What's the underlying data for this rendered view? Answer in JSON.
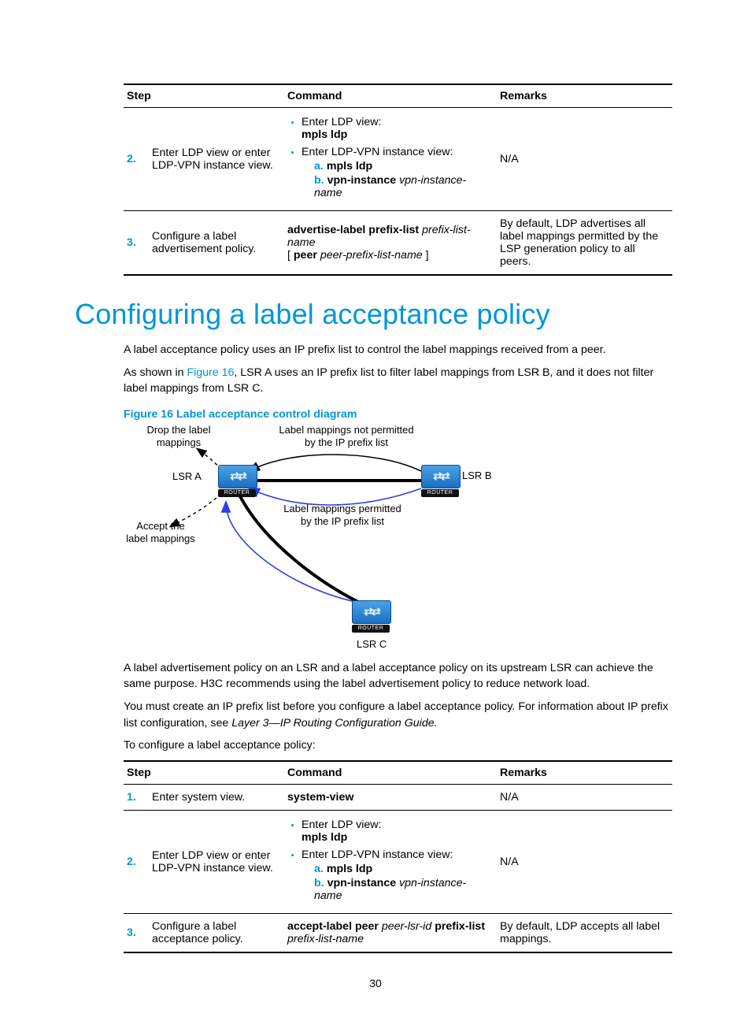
{
  "page_number": "30",
  "table1": {
    "headers": {
      "step": "Step",
      "command": "Command",
      "remarks": "Remarks"
    },
    "row2": {
      "num": "2.",
      "desc": "Enter LDP view or enter LDP-VPN instance view.",
      "b1_text": "Enter LDP view:",
      "b1_cmd": "mpls ldp",
      "b2_text": "Enter LDP-VPN instance view:",
      "b2_sa_lbl": "a.",
      "b2_sa_cmd": "mpls ldp",
      "b2_sb_lbl": "b.",
      "b2_sb_cmd": "vpn-instance",
      "b2_sb_arg": "vpn-instance-name",
      "remarks": "N/A"
    },
    "row3": {
      "num": "3.",
      "desc": "Configure a label advertisement policy.",
      "cmd_b1": "advertise-label prefix-list",
      "cmd_i1": "prefix-list-name",
      "cmd_lb": "[ ",
      "cmd_b2": "peer",
      "cmd_i2": "peer-prefix-list-name",
      "cmd_rb": " ]",
      "remarks": "By default, LDP advertises all label mappings permitted by the LSP generation policy to all peers."
    }
  },
  "section_title": "Configuring a label acceptance policy",
  "paragraphs": {
    "p1": "A label acceptance policy uses an IP prefix list to control the label mappings received from a peer.",
    "p2_pre": "As shown in ",
    "p2_link": "Figure 16",
    "p2_post": ", LSR A uses an IP prefix list to filter label mappings from LSR B, and it does not filter label mappings from LSR C.",
    "p3": "A label advertisement policy on an LSR and a label acceptance policy on its upstream LSR can achieve the same purpose. H3C recommends using the label advertisement policy to reduce network load.",
    "p4_pre": "You must create an IP prefix list before you configure a label acceptance policy. For information about IP prefix list configuration, see ",
    "p4_i": "Layer 3—IP Routing Configuration Guide.",
    "p5": "To configure a label acceptance policy:"
  },
  "figure": {
    "caption": "Figure 16 Label acceptance control diagram",
    "drop": "Drop the label\nmappings",
    "notperm": "Label mappings not permitted\nby the IP prefix list",
    "perm": "Label mappings permitted\nby the IP prefix list",
    "accept": "Accept the\nlabel mappings",
    "lsra": "LSR A",
    "lsrb": "LSR B",
    "lsrc": "LSR C",
    "router_label": "ROUTER"
  },
  "table2": {
    "headers": {
      "step": "Step",
      "command": "Command",
      "remarks": "Remarks"
    },
    "row1": {
      "num": "1.",
      "desc": "Enter system view.",
      "cmd": "system-view",
      "remarks": "N/A"
    },
    "row2": {
      "num": "2.",
      "desc": "Enter LDP view or enter LDP-VPN instance view.",
      "b1_text": "Enter LDP view:",
      "b1_cmd": "mpls ldp",
      "b2_text": "Enter LDP-VPN instance view:",
      "b2_sa_lbl": "a.",
      "b2_sa_cmd": "mpls ldp",
      "b2_sb_lbl": "b.",
      "b2_sb_cmd": "vpn-instance",
      "b2_sb_arg": "vpn-instance-name",
      "remarks": "N/A"
    },
    "row3": {
      "num": "3.",
      "desc": "Configure a label acceptance policy.",
      "cmd_b1": "accept-label peer",
      "cmd_i1": "peer-lsr-id",
      "cmd_b2": "prefix-list",
      "cmd_i2": "prefix-list-name",
      "remarks": "By default, LDP accepts all label mappings."
    }
  }
}
